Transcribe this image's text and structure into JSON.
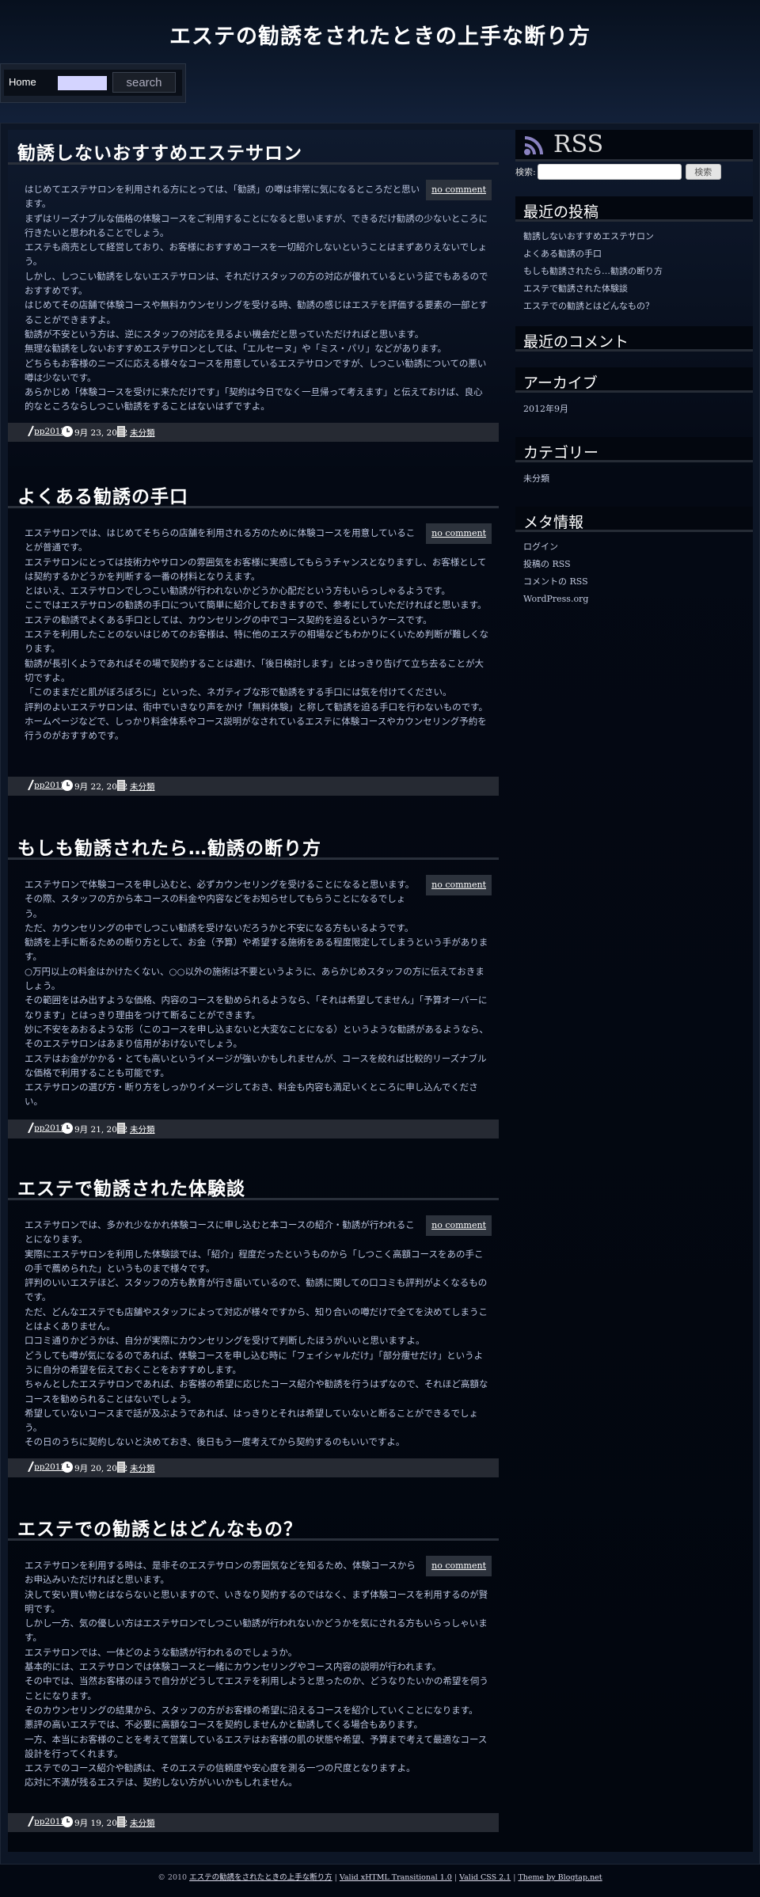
{
  "site_title": "エステの勧誘をされたときの上手な断り方",
  "nav": {
    "home": "Home",
    "search_value": "",
    "search_button": "search"
  },
  "no_comment": "no comment",
  "posts": [
    {
      "title": "勧誘しないおすすめエステサロン",
      "author": "pp2012",
      "date": "9月 23, 2012",
      "category": "未分類",
      "lines": [
        "はじめてエステサロンを利用される方にとっては、「勧誘」の噂は非常に気になるところだと思います。",
        "まずはリーズナブルな価格の体験コースをご利用することになると思いますが、できるだけ勧誘の少ないところに行きたいと思われることでしょう。",
        "エステも商売として経営しており、お客様におすすめコースを一切紹介しないということはまずありえないでしょう。",
        "しかし、しつこい勧誘をしないエステサロンは、それだけスタッフの方の対応が優れているという証でもあるのでおすすめです。",
        "はじめてその店舗で体験コースや無料カウンセリングを受ける時、勧誘の感じはエステを評価する要素の一部とすることができますよ。",
        "勧誘が不安という方は、逆にスタッフの対応を見るよい機会だと思っていただければと思います。",
        "無理な勧誘をしないおすすめエステサロンとしては、「エルセーヌ」や「ミス・パリ」などがあります。",
        "どちらもお客様のニーズに応える様々なコースを用意しているエステサロンですが、しつこい勧誘についての悪い噂は少ないです。",
        "あらかじめ「体験コースを受けに来ただけです」「契約は今日でなく一旦帰って考えます」と伝えておけば、良心的なところならしつこい勧誘をすることはないはずですよ。"
      ]
    },
    {
      "title": "よくある勧誘の手口",
      "author": "pp2012",
      "date": "9月 22, 2012",
      "category": "未分類",
      "lines": [
        "エステサロンでは、はじめてそちらの店舗を利用される方のために体験コースを用意していることが普通です。",
        "エステサロンにとっては技術力やサロンの雰囲気をお客様に実感してもらうチャンスとなりますし、お客様としては契約するかどうかを判断する一番の材料となりえます。",
        "とはいえ、エステサロンでしつこい勧誘が行われないかどうか心配だという方もいらっしゃるようです。",
        "ここではエステサロンの勧誘の手口について簡単に紹介しておきますので、参考にしていただければと思います。",
        "エステの勧誘でよくある手口としては、カウンセリングの中でコース契約を迫るというケースです。",
        "エステを利用したことのないはじめてのお客様は、特に他のエステの相場などもわかりにくいため判断が難しくなります。",
        "勧誘が長引くようであればその場で契約することは避け、「後日検討します」とはっきり告げて立ち去ることが大切ですよ。",
        "「このままだと肌がぼろぼろに」といった、ネガティブな形で勧誘をする手口には気を付けてください。",
        "評判のよいエステサロンは、街中でいきなり声をかけ「無料体験」と称して勧誘を迫る手口を行わないものです。",
        "ホームページなどで、しっかり料金体系やコース説明がなされているエステに体験コースやカウンセリング予約を行うのがおすすめです。"
      ]
    },
    {
      "title": "もしも勧誘されたら…勧誘の断り方",
      "author": "pp2012",
      "date": "9月 21, 2012",
      "category": "未分類",
      "lines": [
        "エステサロンで体験コースを申し込むと、必ずカウンセリングを受けることになると思います。",
        "その際、スタッフの方から本コースの料金や内容などをお知らせしてもらうことになるでしょう。",
        "ただ、カウンセリングの中でしつこい勧誘を受けないだろうかと不安になる方もいるようです。",
        "勧誘を上手に断るための断り方として、お金（予算）や希望する施術をある程度限定してしまうという手があります。",
        "○万円以上の料金はかけたくない、○○以外の施術は不要というように、あらかじめスタッフの方に伝えておきましょう。",
        "その範囲をはみ出すような価格、内容のコースを勧められるようなら、「それは希望してません」「予算オーバーになります」とはっきり理由をつけて断ることができます。",
        "妙に不安をあおるような形（このコースを申し込まないと大変なことになる）というような勧誘があるようなら、そのエステサロンはあまり信用がおけないでしょう。",
        "エステはお金がかかる・とても高いというイメージが強いかもしれませんが、コースを絞れば比較的リーズナブルな価格で利用することも可能です。",
        "エステサロンの選び方・断り方をしっかりイメージしておき、料金も内容も満足いくところに申し込んでください。"
      ]
    },
    {
      "title": "エステで勧誘された体験談",
      "author": "pp2012",
      "date": "9月 20, 2012",
      "category": "未分類",
      "lines": [
        "エステサロンでは、多かれ少なかれ体験コースに申し込むと本コースの紹介・勧誘が行われることになります。",
        "実際にエステサロンを利用した体験談では、「紹介」程度だったというものから「しつこく高額コースをあの手この手で薦められた」というものまで様々です。",
        "評判のいいエステほど、スタッフの方も教育が行き届いているので、勧誘に関しての口コミも評判がよくなるものです。",
        "ただ、どんなエステでも店舗やスタッフによって対応が様々ですから、知り合いの噂だけで全てを決めてしまうことはよくありません。",
        "口コミ通りかどうかは、自分が実際にカウンセリングを受けて判断したほうがいいと思いますよ。",
        "どうしても噂が気になるのであれば、体験コースを申し込む時に「フェイシャルだけ」「部分痩せだけ」というように自分の希望を伝えておくことをおすすめします。",
        "ちゃんとしたエステサロンであれば、お客様の希望に応じたコース紹介や勧誘を行うはずなので、それほど高額なコースを勧められることはないでしょう。",
        "希望していないコースまで話が及ぶようであれば、はっきりとそれは希望していないと断ることができるでしょう。",
        "その日のうちに契約しないと決めておき、後日もう一度考えてから契約するのもいいですよ。"
      ]
    },
    {
      "title": "エステでの勧誘とはどんなもの？",
      "author": "pp2012",
      "date": "9月 19, 2012",
      "category": "未分類",
      "lines": [
        "エステサロンを利用する時は、是非そのエステサロンの雰囲気などを知るため、体験コースからお申込みいただければと思います。",
        "決して安い買い物とはならないと思いますので、いきなり契約するのではなく、まず体験コースを利用するのが賢明です。",
        "しかし一方、気の優しい方はエステサロンでしつこい勧誘が行われないかどうかを気にされる方もいらっしゃいます。",
        "エステサロンでは、一体どのような勧誘が行われるのでしょうか。",
        "基本的には、エステサロンでは体験コースと一緒にカウンセリングやコース内容の説明が行われます。",
        "その中では、当然お客様のほうで自分がどうしてエステを利用しようと思ったのか、どうなりたいかの希望を伺うことになります。",
        "そのカウンセリングの結果から、スタッフの方がお客様の希望に沿えるコースを紹介していくことになります。",
        "悪評の高いエステでは、不必要に高額なコースを契約しませんかと勧誘してくる場合もあります。",
        "一方、本当にお客様のことを考えて営業しているエステはお客様の肌の状態や希望、予算まで考えて最適なコース設計を行ってくれます。",
        "エステでのコース紹介や勧誘は、そのエステの信頼度や安心度を測る一つの尺度となりますよ。",
        "応対に不満が残るエステは、契約しない方がいいかもしれません。"
      ]
    }
  ],
  "sidebar": {
    "rss_label": "RSS",
    "search_label": "検索:",
    "search_value": "",
    "search_button": "検索",
    "recent_posts_title": "最近の投稿",
    "recent_posts": [
      "勧誘しないおすすめエステサロン",
      "よくある勧誘の手口",
      "もしも勧誘されたら…勧誘の断り方",
      "エステで勧誘された体験談",
      "エステでの勧誘とはどんなもの？"
    ],
    "recent_comments_title": "最近のコメント",
    "archives_title": "アーカイブ",
    "archives": [
      "2012年9月"
    ],
    "categories_title": "カテゴリー",
    "categories": [
      "未分類"
    ],
    "meta_title": "メタ情報",
    "meta": [
      "ログイン",
      "投稿の RSS",
      "コメントの RSS",
      "WordPress.org"
    ]
  },
  "footer": {
    "copy": "© 2010",
    "site_link": "エステの勧誘をされたときの上手な断り方",
    "sep": "|",
    "xhtml": "Valid xHTML Transitional 1.0",
    "css": "Valid CSS 2.1",
    "theme": "Theme by Blogtap.net"
  }
}
